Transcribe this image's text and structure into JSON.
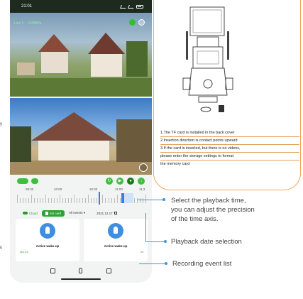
{
  "phone": {
    "status_time": "21:01",
    "live_label": "Live 1",
    "live_rate": "120KB/s",
    "timeline_ticks": [
      "09:30",
      "10:00",
      "10:30",
      "11:00",
      "11:3"
    ],
    "tabs": {
      "cloud": "Cloud",
      "sd_card": "SD card",
      "all_events": "All events",
      "date": "2021.12.17"
    },
    "cards": [
      {
        "label": "Active wake-up",
        "time": "@21:0"
      },
      {
        "label": "Active wake-up",
        "time": "2s"
      }
    ]
  },
  "left_fragments": [
    "y",
    "u"
  ],
  "notes": [
    "1.The TF card is installed in the back cover",
    "2.Insertion direction is contact points upward",
    "3.If the card is inserted, but there is no videos,",
    "please enter the storage settings to format",
    "the memory card"
  ],
  "annotations": {
    "playback_time": "Select the playback time,\nyou can adjust the precision\nof the time axis.",
    "date_selection": "Playback date selection",
    "event_list": "Recording event list"
  },
  "colors": {
    "accent": "#3cbf3c",
    "annotation": "#3f95d8",
    "callout_border": "#f0a65c"
  }
}
